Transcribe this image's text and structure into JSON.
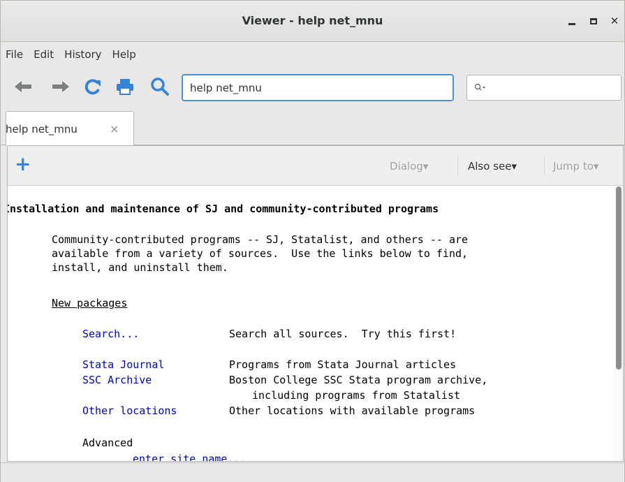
{
  "window": {
    "title": "Viewer - help net_mnu"
  },
  "menu": [
    "File",
    "Edit",
    "History",
    "Help"
  ],
  "toolbar": {
    "address_value": "help net_mnu",
    "search_placeholder": ""
  },
  "tabs": [
    {
      "label": "help net_mnu",
      "close": "×"
    }
  ],
  "viewer_toolbar": {
    "add": "+",
    "dialog": "Dialog▾",
    "also_see": "Also see▾",
    "jump_to": "Jump to▾"
  },
  "doc": {
    "heading": "Installation and maintenance of SJ and community-contributed programs",
    "intro": [
      "Community-contributed programs -- SJ, Statalist, and others -- are",
      "available from a variety of sources.  Use the links below to find,",
      "install, and uninstall them."
    ],
    "section_new_packages": "New packages",
    "rows": [
      {
        "link": "Search...",
        "desc": "Search all sources.  Try this first!"
      },
      {
        "link": "Stata Journal",
        "desc": "Programs from Stata Journal articles"
      },
      {
        "link": "SSC Archive",
        "desc": "Boston College SSC Stata program archive,",
        "desc2": "including programs from Statalist"
      },
      {
        "link": "Other locations",
        "desc": "Other locations with available programs"
      }
    ],
    "advanced": "Advanced",
    "enter_site": "enter site name..."
  },
  "colors": {
    "link": "#0000cc",
    "accent": "#3583d6",
    "focus": "#4a90d9"
  }
}
